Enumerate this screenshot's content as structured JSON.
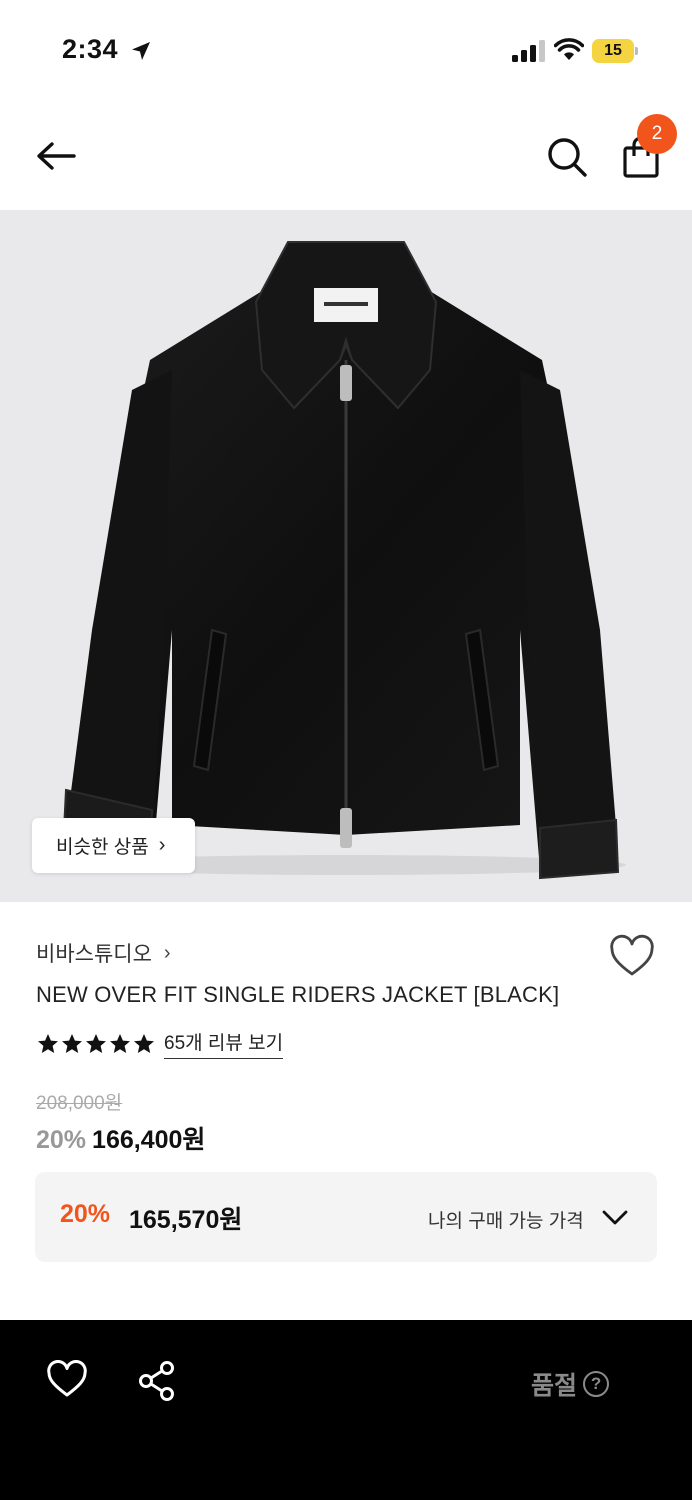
{
  "status_bar": {
    "time": "2:34",
    "battery": "15"
  },
  "header": {
    "cart_count": "2"
  },
  "product_image": {
    "similar_label": "비슷한 상품",
    "similar_chevron": "›"
  },
  "product": {
    "brand": "비바스튜디오",
    "brand_chevron": "›",
    "name": "NEW OVER FIT SINGLE RIDERS JACKET [BLACK]",
    "rating_stars": 5,
    "review_link": "65개 리뷰 보기",
    "original_price": "208,000원",
    "discount_pct": "20%",
    "sale_price": "166,400원"
  },
  "my_price": {
    "discount_pct": "20%",
    "price": "165,570원",
    "label": "나의 구매 가능 가격"
  },
  "bottom_bar": {
    "status": "품절",
    "help_symbol": "?"
  },
  "colors": {
    "accent": "#f1551c",
    "image_bg": "#e9e9eb",
    "bottom_bar": "#000000",
    "battery": "#f5d442"
  },
  "icons": [
    "location-arrow-icon",
    "signal-icon",
    "wifi-icon",
    "battery-icon",
    "back-arrow-icon",
    "search-icon",
    "shopping-bag-icon",
    "heart-icon",
    "star-icon",
    "chevron-down-icon",
    "share-icon",
    "help-icon"
  ]
}
